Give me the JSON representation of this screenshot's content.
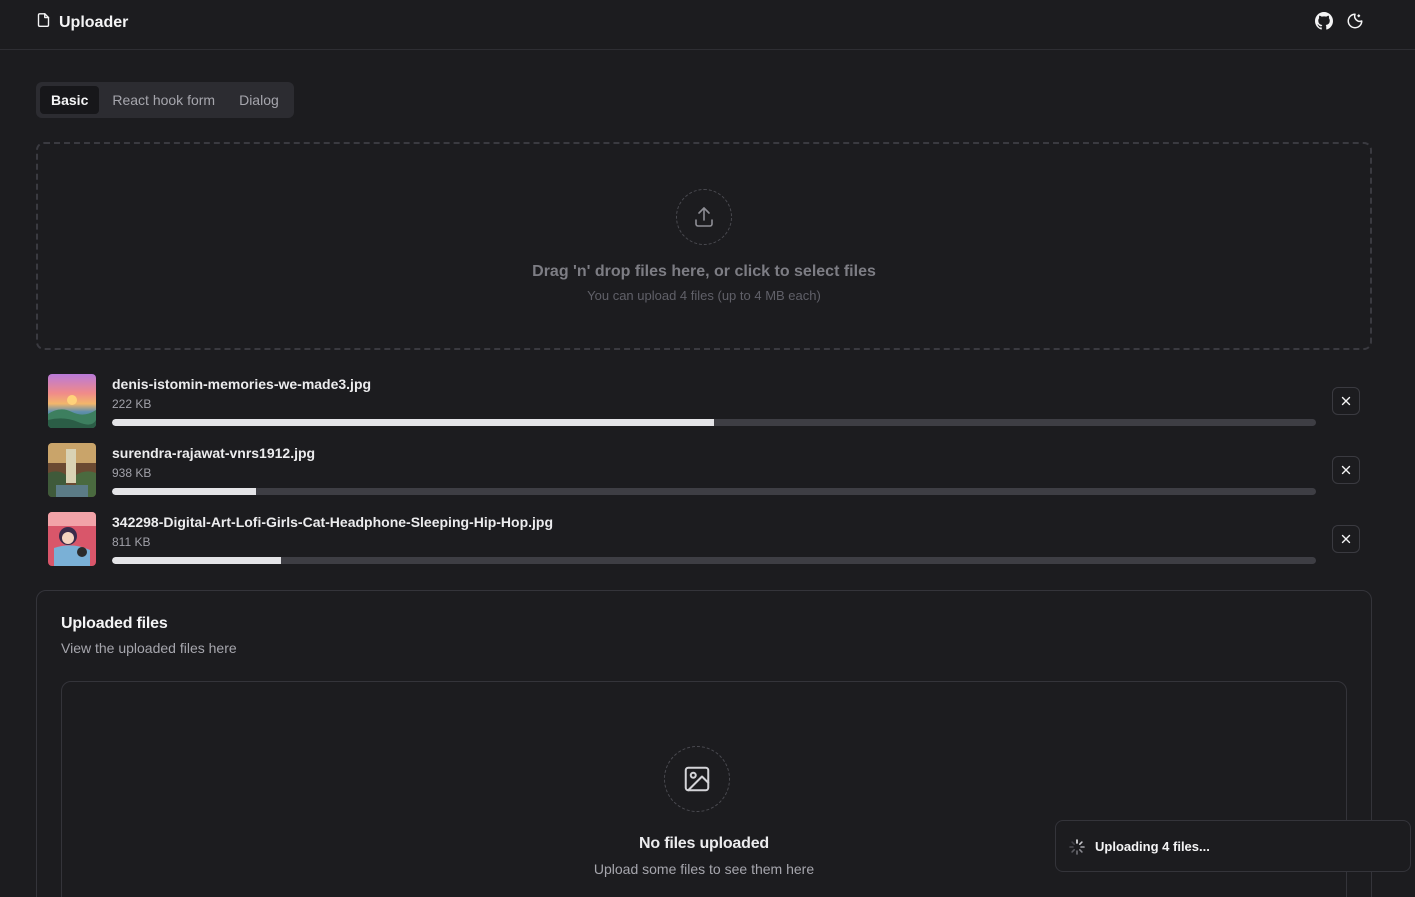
{
  "header": {
    "title": "Uploader",
    "brand_icon": "file-icon",
    "github_icon": "github-icon",
    "theme_icon": "theme-toggle-icon"
  },
  "tabs": [
    {
      "label": "Basic",
      "active": true
    },
    {
      "label": "React hook form",
      "active": false
    },
    {
      "label": "Dialog",
      "active": false
    }
  ],
  "dropzone": {
    "icon": "upload-icon",
    "title": "Drag 'n' drop files here, or click to select files",
    "subtitle": "You can upload 4 files (up to 4 MB each)"
  },
  "files": [
    {
      "name": "denis-istomin-memories-we-made3.jpg",
      "size": "222 KB",
      "progress_percent": 50
    },
    {
      "name": "surendra-rajawat-vnrs1912.jpg",
      "size": "938 KB",
      "progress_percent": 12
    },
    {
      "name": "342298-Digital-Art-Lofi-Girls-Cat-Headphone-Sleeping-Hip-Hop.jpg",
      "size": "811 KB",
      "progress_percent": 14
    }
  ],
  "uploaded_card": {
    "title": "Uploaded files",
    "description": "View the uploaded files here",
    "empty_icon": "image-icon",
    "empty_title": "No files uploaded",
    "empty_subtitle": "Upload some files to see them here"
  },
  "toast": {
    "text": "Uploading 4 files...",
    "icon": "spinner-icon"
  },
  "colors": {
    "background": "#1c1c1f",
    "progress_fill": "#e4e4e7",
    "progress_track": "#3e3e44"
  }
}
